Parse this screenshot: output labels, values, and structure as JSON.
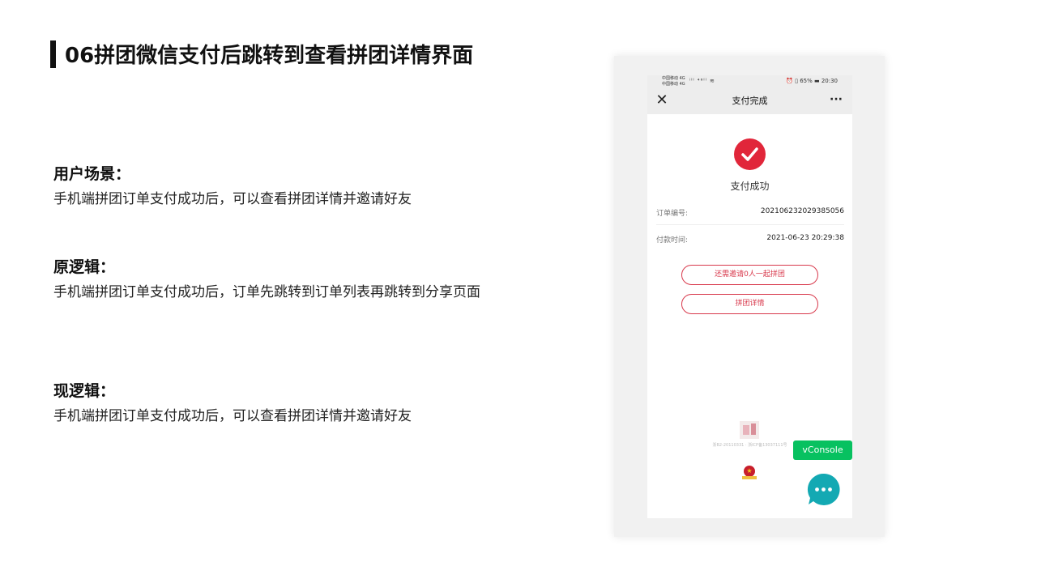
{
  "slide": {
    "title": "06拼团微信支付后跳转到查看拼团详情界面"
  },
  "sections": [
    {
      "heading": "用户场景：",
      "body": "手机端拼团订单支付成功后，可以查看拼团详情并邀请好友"
    },
    {
      "heading": "原逻辑：",
      "body": "手机端拼团订单支付成功后，订单先跳转到订单列表再跳转到分享页面"
    },
    {
      "heading": "现逻辑：",
      "body": "手机端拼团订单支付成功后，可以查看拼团详情并邀请好友"
    }
  ],
  "phone": {
    "statusbar": {
      "carrier_1": "中国移动 4G",
      "carrier_2": "中国移动 4G",
      "signal": "ⁱˡˡ ⁴⁶ˡˡ ≋",
      "right": "⏰ ▯ 65% ▬ 20:30"
    },
    "nav": {
      "close_icon": "close-icon",
      "title": "支付完成",
      "more_icon": "more-icon"
    },
    "success_text": "支付成功",
    "order_no": {
      "label": "订单编号:",
      "value": "202106232029385056"
    },
    "pay_time": {
      "label": "付款时间:",
      "value": "2021-06-23 20:29:38"
    },
    "buttons": {
      "invite": "还需邀请0人一起拼团",
      "detail": "拼团详情"
    },
    "footer": {
      "icp": "浙B2-20110331 · 浙ICP备13037111号"
    },
    "vconsole": "vConsole",
    "colors": {
      "accent": "#e1263a",
      "vconsole": "#07c160",
      "chat": "#13a9b3"
    }
  }
}
